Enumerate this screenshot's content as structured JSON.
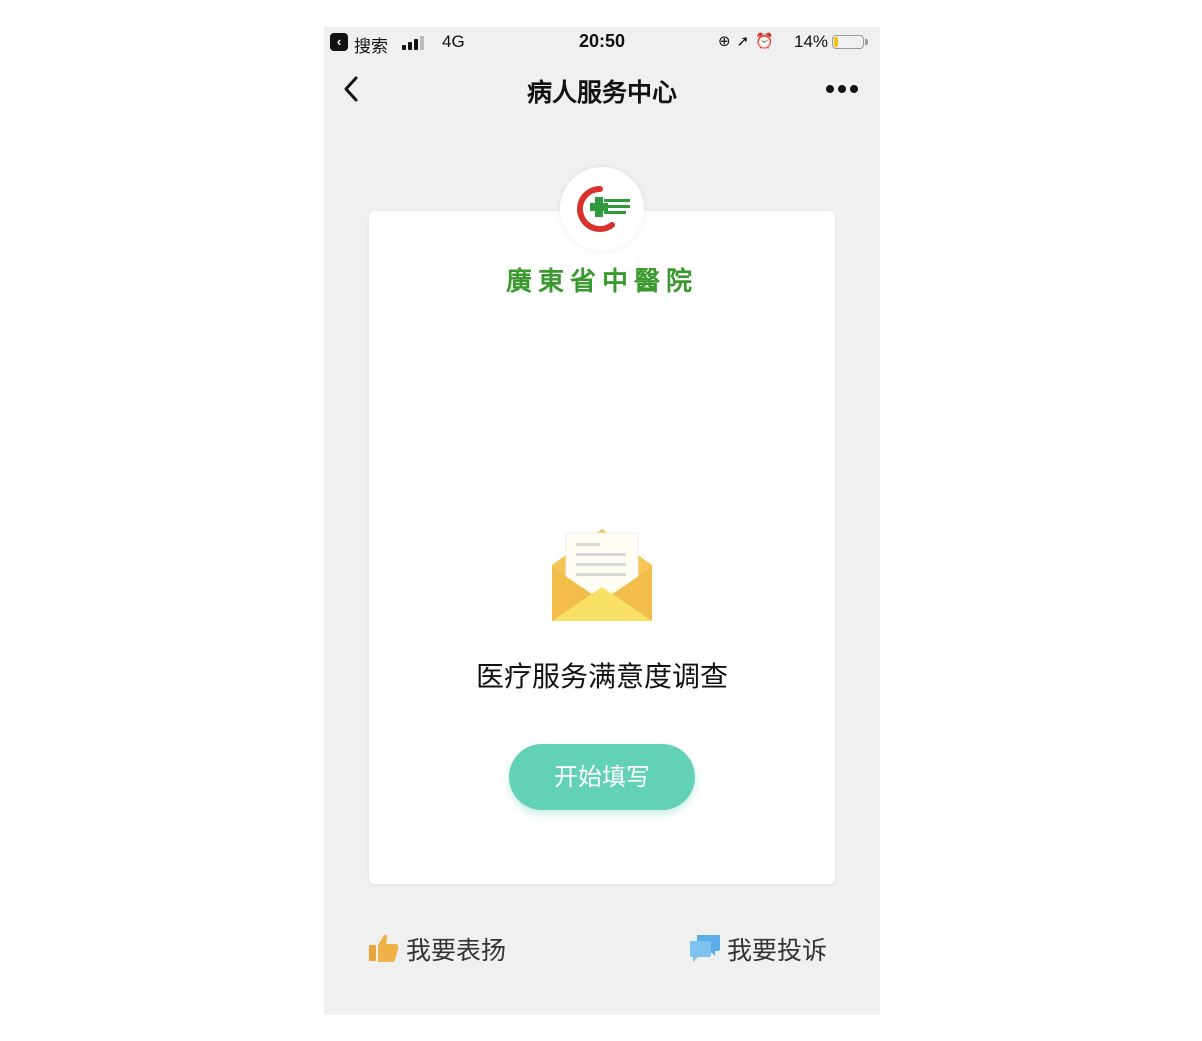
{
  "status_bar": {
    "back_app_label": "搜索",
    "network": "4G",
    "time": "20:50",
    "battery_percent": "14%",
    "battery_level": 0.14,
    "icons": [
      "orientation-lock-icon",
      "location-icon",
      "alarm-icon"
    ]
  },
  "nav": {
    "title": "病人服务中心"
  },
  "hospital": {
    "name": "廣東省中醫院"
  },
  "survey": {
    "title": "医疗服务满意度调查",
    "start_button": "开始填写"
  },
  "actions": {
    "praise_label": "我要表扬",
    "complain_label": "我要投诉"
  },
  "colors": {
    "accent": "#62d1b6",
    "hospital_green": "#3b9a2f",
    "envelope_yellow": "#f5c557",
    "praise_icon": "#f2b24a",
    "complain_icon": "#5aaee8"
  }
}
